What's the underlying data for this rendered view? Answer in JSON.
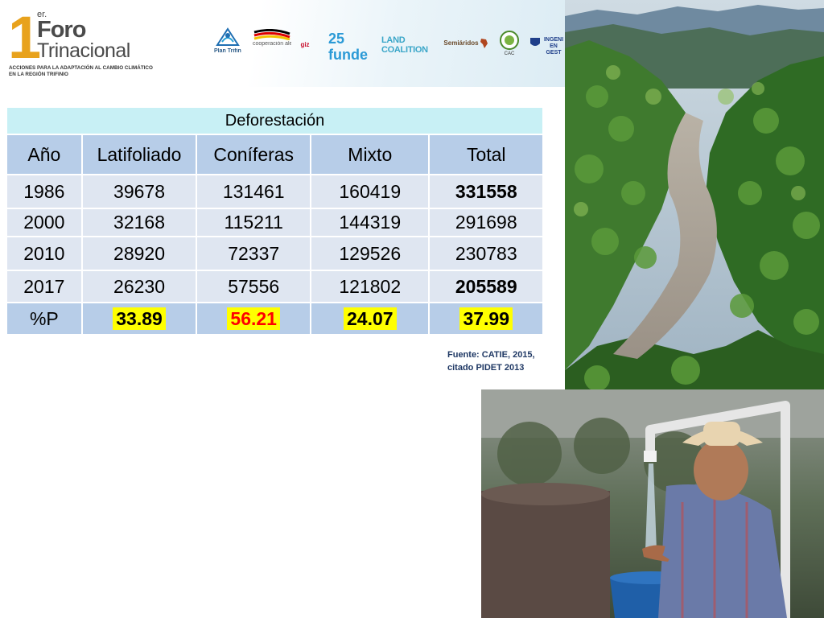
{
  "header": {
    "logo_number": "1",
    "logo_superscript": "er.",
    "logo_word1": "Foro",
    "logo_word2": "Trinacional",
    "subtitle_line1": "ACCIONES PARA LA ADAPTACIÓN AL CAMBIO CLIMÁTICO",
    "subtitle_line2": "EN LA REGIÓN TRIFINIO",
    "partners": [
      "Plan Trifinio",
      "cooperación alemana",
      "giz",
      "25 funde",
      "LAND COALITION",
      "Semiáridos",
      "CAC",
      "INGENI EN GEST"
    ]
  },
  "table": {
    "title": "Deforestación",
    "columns": [
      "Año",
      "Latifoliado",
      "Coníferas",
      "Mixto",
      "Total"
    ],
    "rows": [
      [
        "1986",
        "39678",
        "131461",
        "160419",
        "331558"
      ],
      [
        "2000",
        "32168",
        "115211",
        "144319",
        "291698"
      ],
      [
        "2010",
        "28920",
        "72337",
        "129526",
        "230783"
      ],
      [
        "2017",
        "26230",
        "57556",
        "121802",
        "205589"
      ]
    ],
    "pct_label": "%P",
    "pct_values": [
      "33.89",
      "56.21",
      "24.07",
      "37.99"
    ]
  },
  "source_line1": "Fuente: CATIE, 2015,",
  "source_line2": "citado PIDET 2013",
  "colors": {
    "accent_orange": "#e8a21c",
    "table_title_bg": "#c8f0f5",
    "table_header_bg": "#b7cde8",
    "table_row_bg": "#dfe6f1",
    "highlight": "#ffff00",
    "red_value": "#ff0000"
  }
}
